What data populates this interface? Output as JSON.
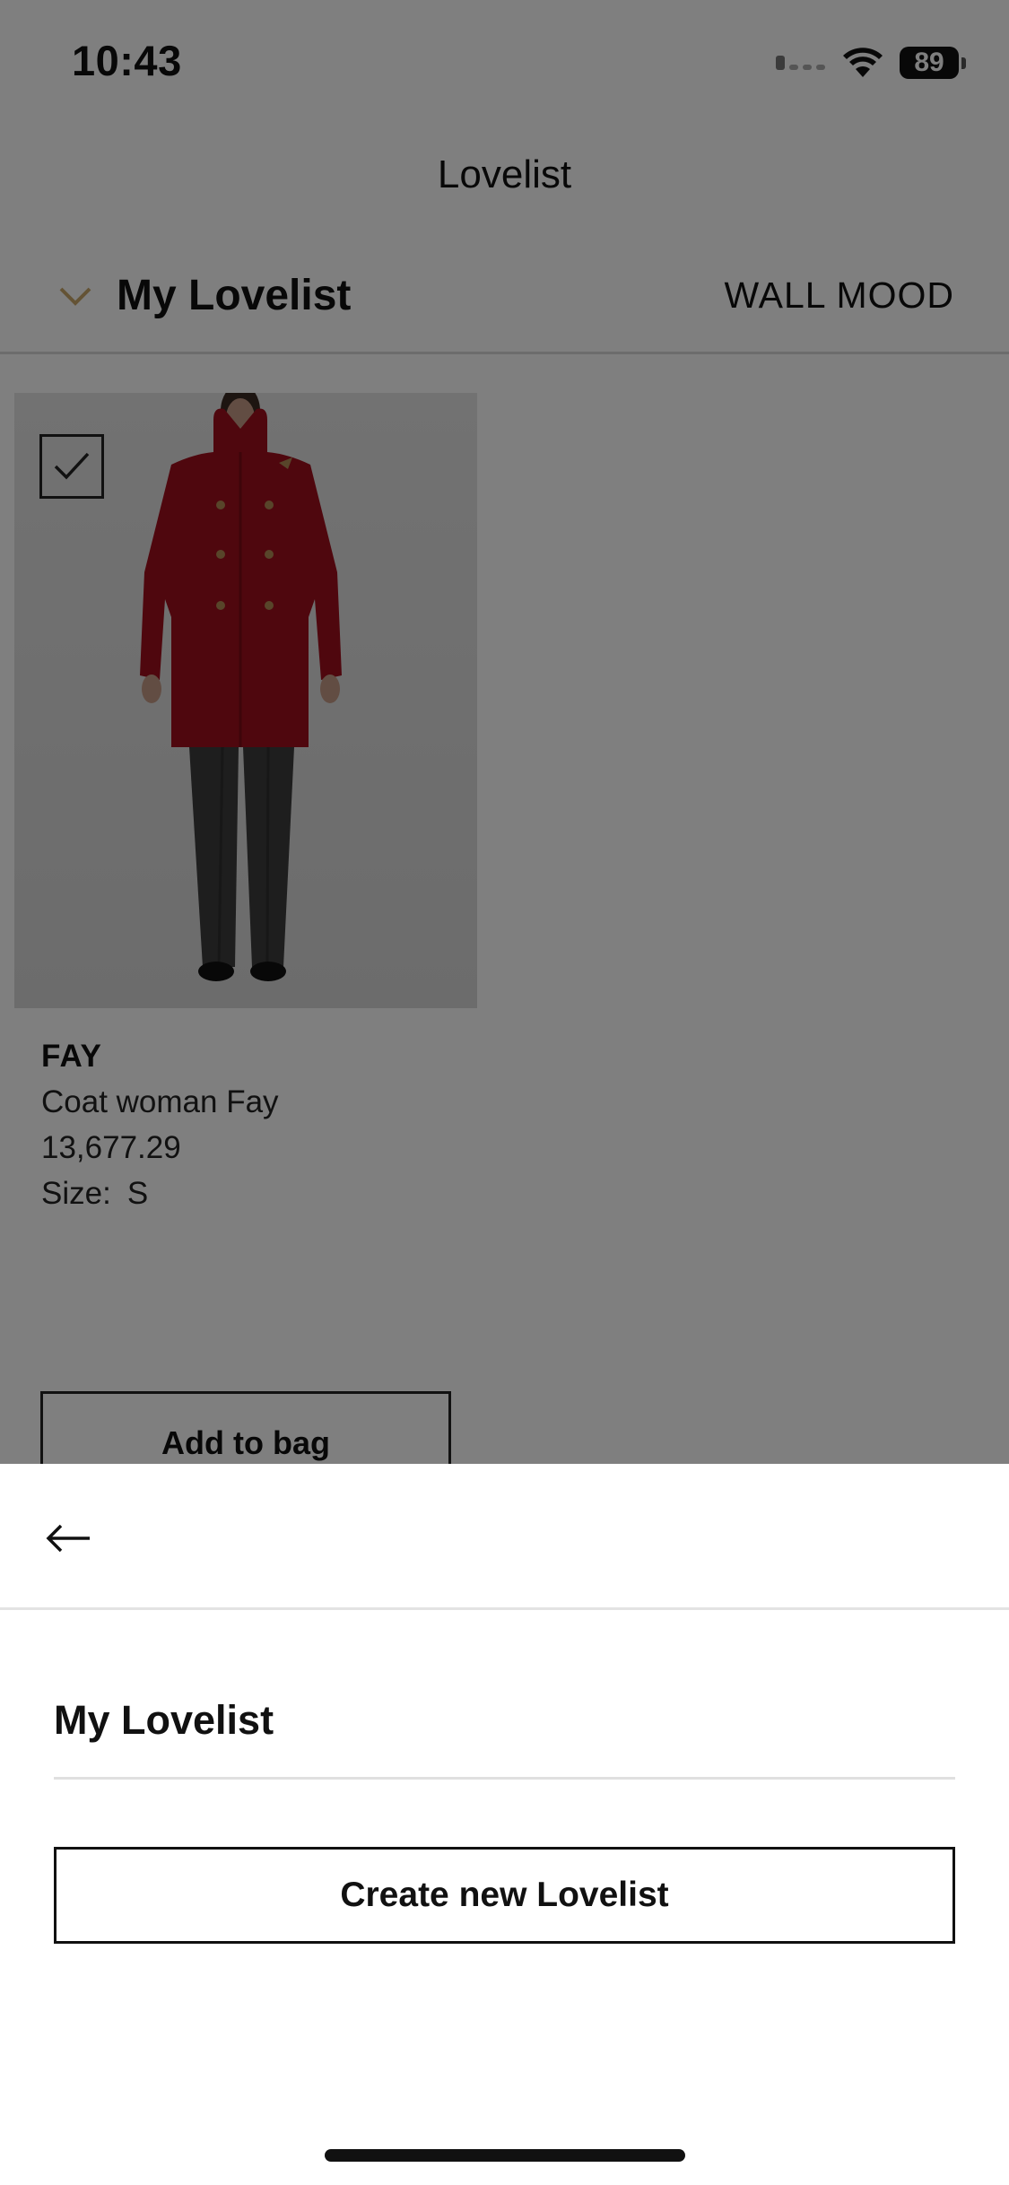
{
  "status_bar": {
    "time": "10:43",
    "battery": "89",
    "icons": [
      "signal-icon",
      "wifi-icon",
      "battery-icon"
    ]
  },
  "nav": {
    "title": "Lovelist"
  },
  "lovelist_header": {
    "list_name": "My Lovelist",
    "wall_mood_label": "WALL MOOD",
    "chevron_color": "#c9a76a"
  },
  "product": {
    "brand": "FAY",
    "description": "Coat woman Fay",
    "price": "13,677.29",
    "size_label": "Size:",
    "size_value": "S",
    "selected": true,
    "add_to_bag_label": "Add to bag",
    "coat_color": "#9e0e1c"
  },
  "sheet": {
    "lists": [
      {
        "label": "My Lovelist"
      }
    ],
    "create_label": "Create new Lovelist"
  }
}
